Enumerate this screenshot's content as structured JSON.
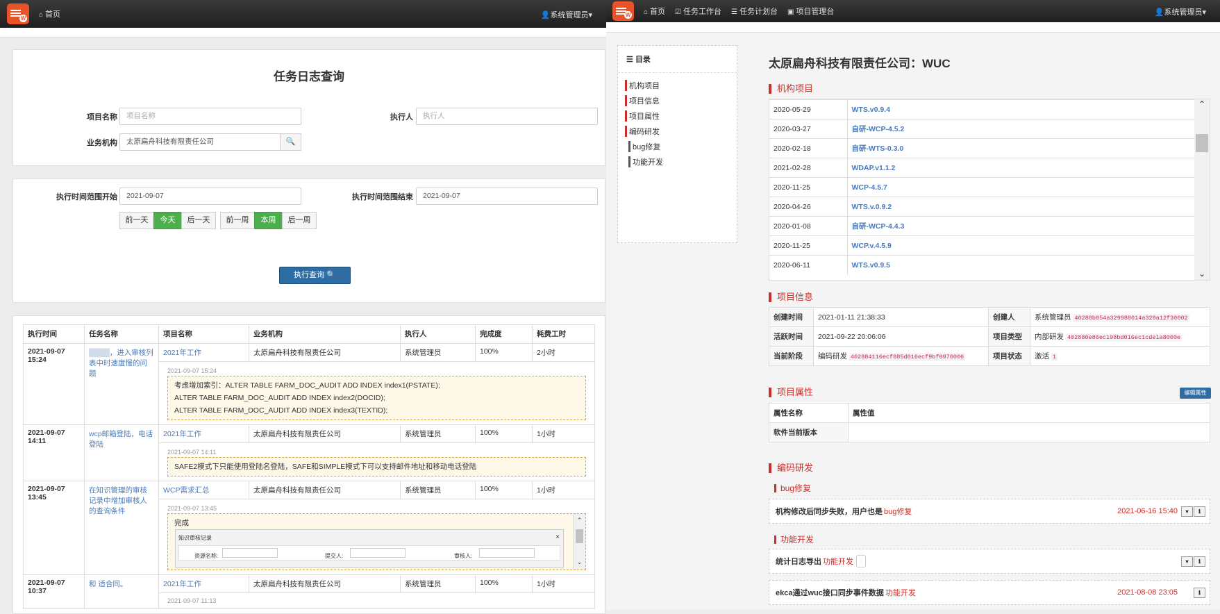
{
  "left": {
    "nav": {
      "home": "首页",
      "user": "系统管理员"
    },
    "title": "任务日志查询",
    "form": {
      "project_label": "项目名称",
      "project_ph": "项目名称",
      "exec_label": "执行人",
      "exec_ph": "执行人",
      "org_label": "业务机构",
      "org_value": "太原扁舟科技有限责任公司"
    },
    "range": {
      "start_label": "执行时间范围开始",
      "start_value": "2021-09-07",
      "end_label": "执行时间范围结束",
      "end_value": "2021-09-07",
      "buttons": [
        "前一天",
        "今天",
        "后一天",
        "前一周",
        "本周",
        "后一周"
      ],
      "query": "执行查询"
    },
    "table": {
      "headers": [
        "执行时间",
        "任务名称",
        "项目名称",
        "业务机构",
        "执行人",
        "完成度",
        "耗费工时"
      ],
      "rows": [
        {
          "date": "2021-09-07",
          "time": "15:24",
          "task": "，进入审核列表中时速度慢的问题",
          "project": "2021年工作",
          "org": "太原扁舟科技有限责任公司",
          "user": "系统管理员",
          "pct": "100%",
          "hours": "2小时",
          "ts": "2021-09-07 15:24",
          "note": [
            "考虑增加索引：ALTER TABLE FARM_DOC_AUDIT ADD INDEX index1(PSTATE);",
            "ALTER TABLE FARM_DOC_AUDIT ADD INDEX index2(DOCID);",
            "ALTER TABLE FARM_DOC_AUDIT ADD INDEX index3(TEXTID);"
          ]
        },
        {
          "date": "2021-09-07",
          "time": "14:11",
          "task": "wcp邮箱登陆，电话登陆",
          "project": "2021年工作",
          "org": "太原扁舟科技有限责任公司",
          "user": "系统管理员",
          "pct": "100%",
          "hours": "1小时",
          "ts": "2021-09-07 14:11",
          "note": [
            "SAFE2模式下只能使用登陆名登陆，SAFE和SIMPLE模式下可以支持邮件地址和移动电话登陆"
          ]
        },
        {
          "date": "2021-09-07",
          "time": "13:45",
          "task": "在知识管理的审核记录中增加审核人的查询条件",
          "project": "WCP需求汇总",
          "org": "太原扁舟科技有限责任公司",
          "user": "系统管理员",
          "pct": "100%",
          "hours": "1小时",
          "ts": "2021-09-07 13:45",
          "note": [
            "完成"
          ],
          "dialog": {
            "title": "知识审核记录",
            "f1": "资源名称:",
            "f2": "提交人:",
            "f3": "审核人:"
          }
        },
        {
          "date": "2021-09-07",
          "time": "10:37",
          "task": "和 适合同。",
          "project": "2021年工作",
          "org": "太原扁舟科技有限责任公司",
          "user": "系统管理员",
          "pct": "100%",
          "hours": "1小时",
          "ts": "2021-09-07 11:13"
        }
      ]
    }
  },
  "right": {
    "nav": {
      "items": [
        "首页",
        "任务工作台",
        "任务计划台",
        "项目管理台"
      ],
      "user": "系统管理员"
    },
    "toc": {
      "title": "目录",
      "items": [
        "机构项目",
        "项目信息",
        "项目属性",
        "编码研发"
      ],
      "subitems": [
        "bug修复",
        "功能开发"
      ]
    },
    "heading": "太原扁舟科技有限责任公司：WUC",
    "sections": {
      "org_projects": "机构项目",
      "info": "项目信息",
      "attrs": "项目属性",
      "dev": "编码研发",
      "bug": "bug修复",
      "feature": "功能开发"
    },
    "projects": [
      {
        "date": "2020-05-29",
        "name": "WTS.v0.9.4"
      },
      {
        "date": "2020-03-27",
        "name": "自研-WCP-4.5.2"
      },
      {
        "date": "2020-02-18",
        "name": "自研-WTS-0.3.0"
      },
      {
        "date": "2021-02-28",
        "name": "WDAP.v1.1.2"
      },
      {
        "date": "2020-11-25",
        "name": "WCP-4.5.7"
      },
      {
        "date": "2020-04-26",
        "name": "WTS.v.0.9.2"
      },
      {
        "date": "2020-01-08",
        "name": "自研-WCP-4.4.3"
      },
      {
        "date": "2020-11-25",
        "name": "WCP.v.4.5.9"
      },
      {
        "date": "2020-06-11",
        "name": "WTS.v0.9.5"
      }
    ],
    "info": {
      "created_label": "创建时间",
      "created": "2021-01-11 21:38:33",
      "creator_label": "创建人",
      "creator": "系统管理员",
      "creator_id": "40288b854a329988014a329a12f30002",
      "active_label": "活跃时间",
      "active": "2021-09-22 20:06:06",
      "type_label": "项目类型",
      "type": "内部研发",
      "type_id": "402880e86ec198bd016ec1cde1a8000e",
      "stage_label": "当前阶段",
      "stage": "编码研发",
      "stage_id": "402884116ecf885d016ecf9bf0970006",
      "status_label": "项目状态",
      "status": "激活",
      "status_id": "1"
    },
    "attrs": {
      "edit": "编辑属性",
      "col1": "属性名称",
      "col2": "属性值",
      "row_name": "软件当前版本"
    },
    "bug_cards": [
      {
        "title": "机构修改后同步失败，用户也是",
        "tag": "bug修复",
        "date": "2021-06-16 15:40"
      }
    ],
    "feature_cards": [
      {
        "title": "统计日志导出",
        "tag": "功能开发",
        "date": ""
      },
      {
        "title": "ekca通过wuc接口同步事件数据",
        "tag": "功能开发",
        "date": "2021-08-08 23:05"
      }
    ]
  }
}
